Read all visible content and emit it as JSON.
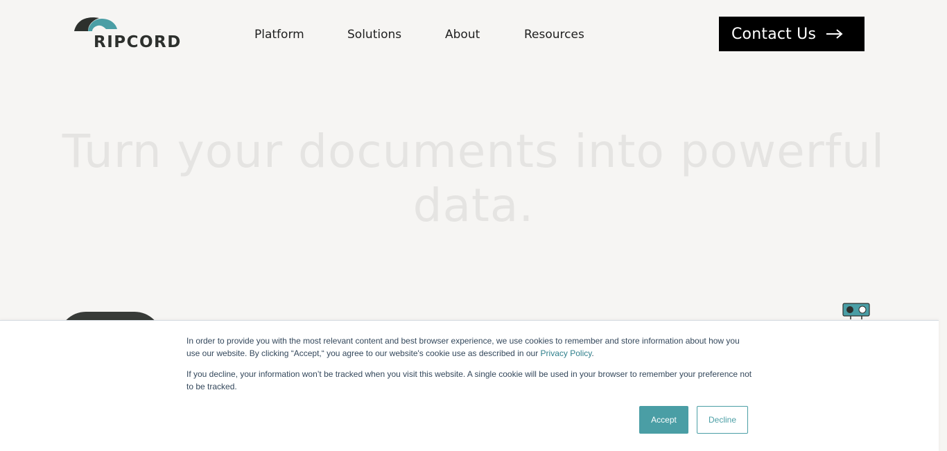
{
  "header": {
    "logo_text": "RIPCORD",
    "nav": [
      {
        "label": "Platform"
      },
      {
        "label": "Solutions"
      },
      {
        "label": "About"
      },
      {
        "label": "Resources"
      }
    ],
    "contact_label": "Contact Us",
    "contact_icon": "arrow-right-icon"
  },
  "hero": {
    "title": "Turn your documents into powerful data."
  },
  "cookie_banner": {
    "paragraph1_before_link": "In order to provide you with the most relevant content and best browser experience, we use cookies to remember and store information about how you use our website. By clicking “Accept,“ you agree to our website's cookie use as described in our ",
    "privacy_link": "Privacy Policy",
    "paragraph1_after_link": ".",
    "paragraph2": "If you decline, your information won’t be tracked when you visit this website. A single cookie will be used in your browser to remember your preference not to be tracked.",
    "accept_label": "Accept",
    "decline_label": "Decline"
  },
  "colors": {
    "page_bg": "#f6f5f3",
    "brand_teal": "#4a9ea5",
    "brand_dark": "#2d302d",
    "cta_bg": "#000000",
    "link": "#2e7f8b",
    "banner_text": "#33475b"
  }
}
